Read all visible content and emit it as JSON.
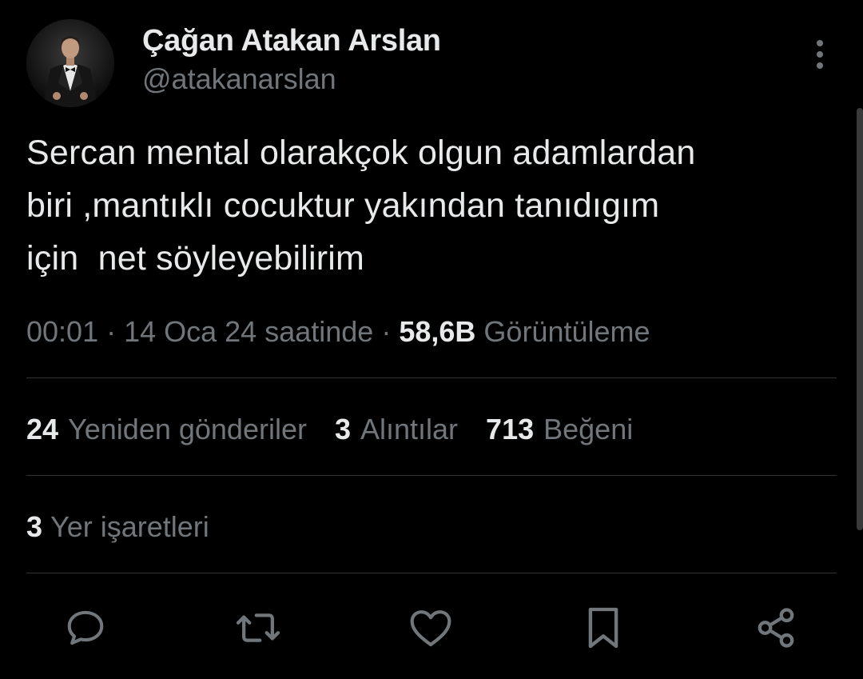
{
  "author": {
    "display_name": "Çağan Atakan Arslan",
    "handle": "@atakanarslan",
    "avatar_icon": "profile-photo"
  },
  "tweet": {
    "text": "Sercan mental olarakçok olgun adamlardan\nbiri ,mantıklı cocuktur yakından tanıdıgım\niçin  net söyleyebilirim"
  },
  "meta": {
    "time": "00:01",
    "separator1": " · ",
    "date": "14 Oca 24 saatinde",
    "separator2": " · ",
    "views_count": "58,6B",
    "views_label": "Görüntüleme"
  },
  "stats": {
    "retweets_count": "24",
    "retweets_label": "Yeniden gönderiler",
    "quotes_count": "3",
    "quotes_label": "Alıntılar",
    "likes_count": "713",
    "likes_label": "Beğeni"
  },
  "bookmarks": {
    "count": "3",
    "label": "Yer işaretleri"
  },
  "actions": {
    "icons": [
      "reply-icon",
      "retweet-icon",
      "like-icon",
      "bookmark-icon",
      "share-icon"
    ]
  },
  "colors": {
    "background": "#000000",
    "primary_text": "#e7e9ea",
    "secondary_text": "#71767b",
    "divider": "#2f3336"
  }
}
